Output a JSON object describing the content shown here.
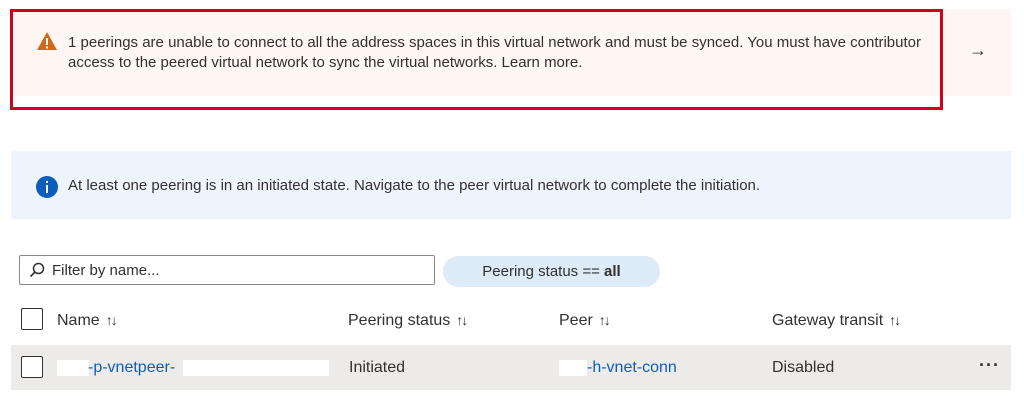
{
  "warning_banner": {
    "message": "1 peerings are unable to connect to all the address spaces in this virtual network and must be synced. You must have contributor access to the peered virtual network to sync the virtual networks. Learn more.",
    "icon": "warning-triangle-icon",
    "arrow": "→",
    "accent_color": "#d0021b"
  },
  "info_banner": {
    "message": "At least one peering is in an initiated state. Navigate to the peer virtual network to complete the initiation.",
    "icon": "info-icon"
  },
  "toolbar": {
    "filter_placeholder": "Filter by name...",
    "status_filter_prefix": "Peering status == ",
    "status_filter_value": "all"
  },
  "table": {
    "columns": [
      {
        "label": "Name",
        "sort": "↑↓"
      },
      {
        "label": "Peering status",
        "sort": "↑↓"
      },
      {
        "label": "Peer",
        "sort": "↑↓"
      },
      {
        "label": "Gateway transit",
        "sort": "↑↓"
      }
    ],
    "rows": [
      {
        "name": "-p-vnetpeer-",
        "peering_status": "Initiated",
        "peer": "-h-vnet-conn",
        "gateway_transit": "Disabled",
        "more": "···"
      }
    ]
  }
}
